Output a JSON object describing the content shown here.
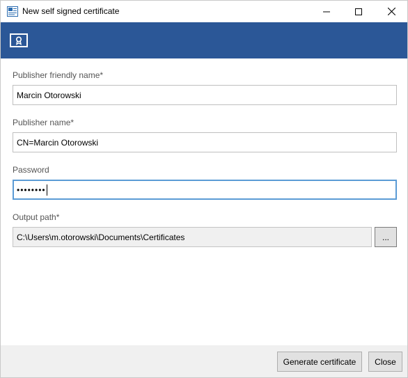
{
  "window": {
    "title": "New self signed certificate",
    "icon": "certificate-app-icon"
  },
  "colors": {
    "banner": "#2b5797",
    "focus_border": "#5b9bd5",
    "footer_bg": "#f0f0f0"
  },
  "form": {
    "friendly_name": {
      "label": "Publisher friendly name",
      "required_mark": "*",
      "value": "Marcin Otorowski"
    },
    "publisher_name": {
      "label": "Publisher name",
      "required_mark": "*",
      "value": "CN=Marcin Otorowski"
    },
    "password": {
      "label": "Password",
      "value": "••••••••"
    },
    "output_path": {
      "label": "Output path",
      "required_mark": "*",
      "value": "C:\\Users\\m.otorowski\\Documents\\Certificates",
      "browse_label": "..."
    }
  },
  "footer": {
    "generate_label": "Generate certificate",
    "close_label": "Close"
  }
}
